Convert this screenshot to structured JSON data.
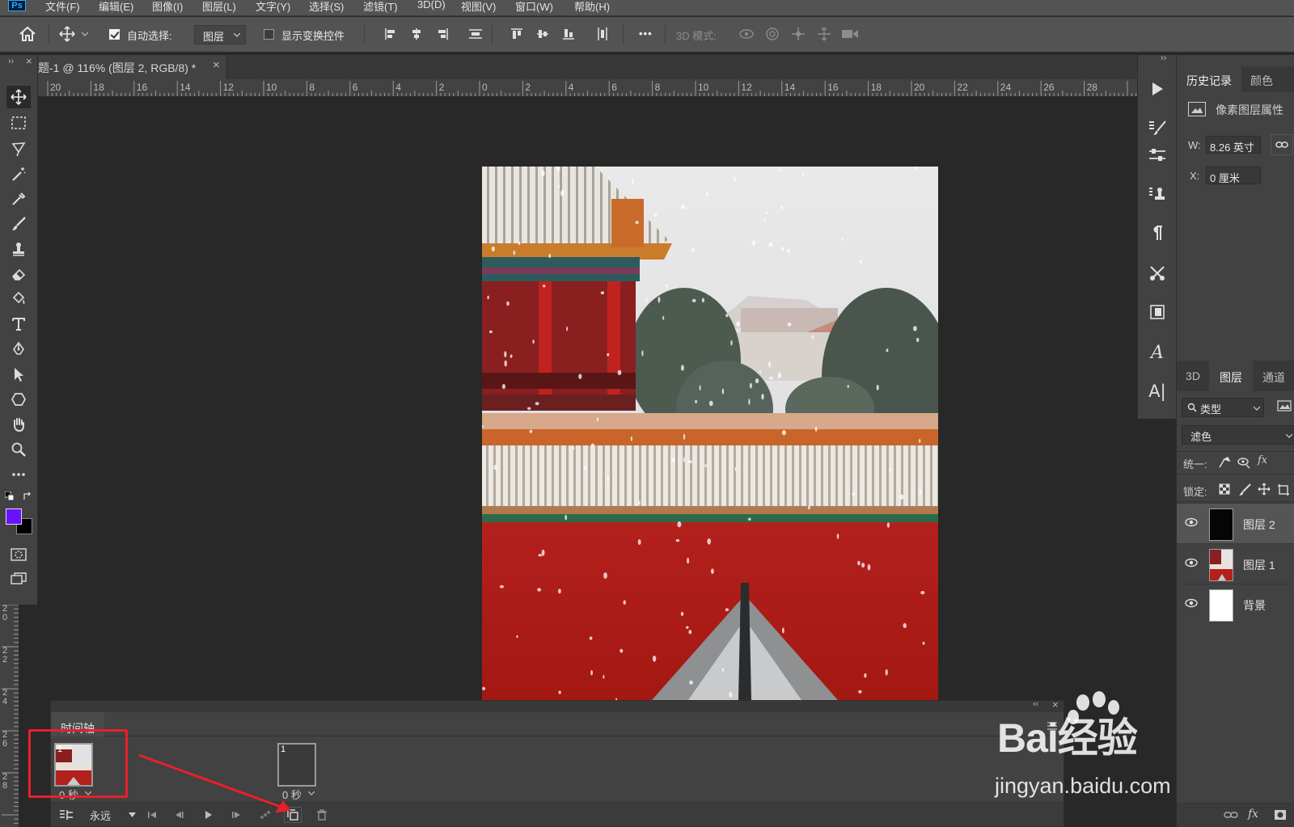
{
  "menubar": {
    "logo": "Ps",
    "items": [
      "文件(F)",
      "编辑(E)",
      "图像(I)",
      "图层(L)",
      "文字(Y)",
      "选择(S)",
      "滤镜(T)",
      "3D(D)",
      "视图(V)",
      "窗口(W)",
      "帮助(H)"
    ]
  },
  "options": {
    "auto_select_label": "自动选择:",
    "auto_select_checked": true,
    "auto_select_value": "图层",
    "show_transform_label": "显示变换控件",
    "show_transform_checked": false,
    "more_label": "•••",
    "mode_3d_label": "3D 模式:"
  },
  "document": {
    "tab_title": "题-1 @ 116% (图层 2, RGB/8) *",
    "close_label": "×"
  },
  "ruler_h_labels": [
    "20",
    "18",
    "16",
    "14",
    "12",
    "10",
    "8",
    "6",
    "4",
    "2",
    "0",
    "2",
    "4",
    "6",
    "8",
    "10",
    "12",
    "14",
    "16",
    "18",
    "20",
    "22",
    "24",
    "26",
    "28"
  ],
  "ruler_v_labels": [
    "2 0",
    "2 2",
    "2 4",
    "2 6",
    "2 8"
  ],
  "colors": {
    "foreground": "#6a12ff",
    "background": "#000000",
    "annotation_red": "#e8202a"
  },
  "right_panel": {
    "tabs_top": [
      "历史记录",
      "颜色"
    ],
    "properties_title": "像素图层属性",
    "w_label": "W:",
    "w_value": "8.26 英寸",
    "x_label": "X:",
    "x_value": "0 厘米",
    "tabs_layers": [
      "3D",
      "图层",
      "通道"
    ],
    "filter_type": "类型",
    "blend_mode": "滤色",
    "unify_label": "统一:",
    "lock_label": "锁定:",
    "fx_label": "fx",
    "layers": [
      {
        "name": "图层 2",
        "selected": true,
        "thumb": "black"
      },
      {
        "name": "图层 1",
        "selected": false,
        "thumb": "photo"
      },
      {
        "name": "背景",
        "selected": false,
        "thumb": "white"
      }
    ]
  },
  "timeline": {
    "tab_label": "时间轴",
    "frames": [
      {
        "number": "1",
        "delay": "0 秒"
      },
      {
        "number": "1",
        "delay": "0 秒"
      }
    ],
    "loop_value": "永远",
    "collapse_label": "‹‹",
    "close_label": "×"
  },
  "watermark": {
    "brand": "Bai经验",
    "url": "jingyan.baidu.com"
  }
}
